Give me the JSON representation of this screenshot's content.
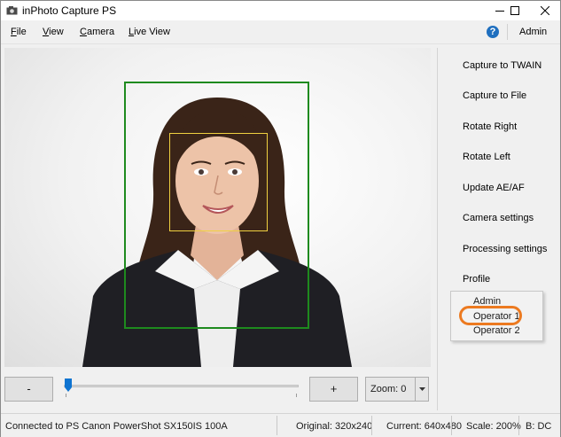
{
  "window": {
    "title": "inPhoto Capture PS"
  },
  "menu": {
    "items": [
      {
        "label": "File",
        "mnemonic": "F",
        "rest": "ile"
      },
      {
        "label": "View",
        "mnemonic": "V",
        "rest": "iew"
      },
      {
        "label": "Camera",
        "mnemonic": "C",
        "rest": "amera"
      },
      {
        "label": "Live View",
        "mnemonic": "L",
        "rest": "ive View"
      }
    ],
    "help_glyph": "?",
    "admin": "Admin"
  },
  "side_buttons": [
    "Capture to TWAIN",
    "Capture to File",
    "Rotate Right",
    "Rotate Left",
    "Update AE/AF",
    "Camera settings",
    "Processing settings",
    "Profile"
  ],
  "profile_dropdown": {
    "options": [
      "Admin",
      "Operator 1",
      "Operator 2"
    ],
    "highlighted": "Operator 1"
  },
  "controls": {
    "minus_label": "-",
    "plus_label": "+",
    "zoom_label": "Zoom: 0",
    "slider_value": 0
  },
  "status": {
    "connection": "Connected to PS Canon PowerShot SX150IS 100A",
    "original": "Original: 320x240",
    "current": "Current: 640x480",
    "scale": "Scale: 200%",
    "extra": "B: DC"
  },
  "colors": {
    "face_frame": "#1e8a1e",
    "face_box": "#f0d040",
    "highlight": "#ec7a20",
    "help_icon": "#1f6fbf"
  }
}
